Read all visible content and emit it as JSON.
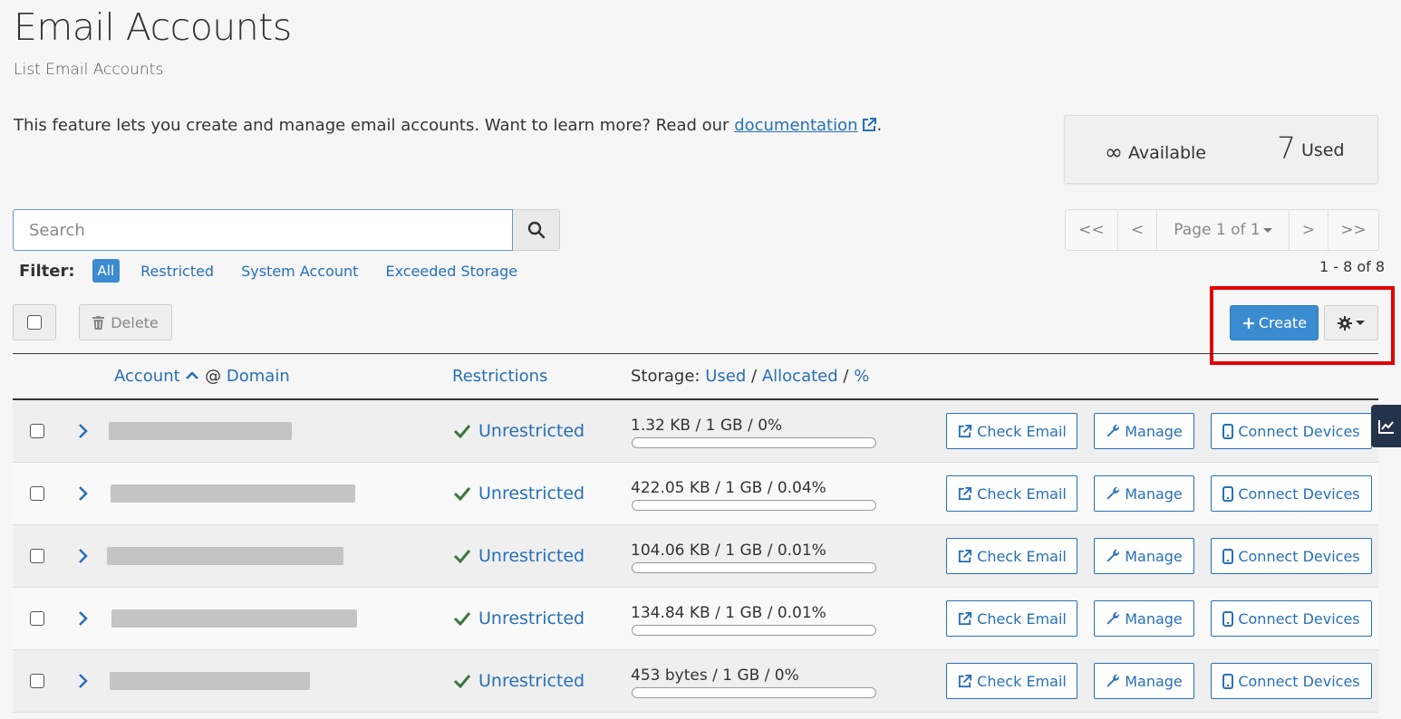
{
  "header": {
    "title": "Email Accounts",
    "subtitle": "List Email Accounts"
  },
  "intro": {
    "text_before": "This feature lets you create and manage email accounts. Want to learn more? Read our ",
    "link_label": "documentation",
    "text_after": "."
  },
  "stats": {
    "available_symbol": "∞",
    "available_label": "Available",
    "used_count": "7",
    "used_label": "Used"
  },
  "search": {
    "placeholder": "Search",
    "value": ""
  },
  "filter": {
    "label": "Filter:",
    "options": [
      "All",
      "Restricted",
      "System Account",
      "Exceeded Storage"
    ],
    "selected": "All"
  },
  "pagination": {
    "first": "<<",
    "prev": "<",
    "page_label": "Page 1 of 1",
    "next": ">",
    "last": ">>",
    "count_text": "1 - 8 of 8"
  },
  "toolbar": {
    "delete_label": "Delete",
    "create_label": "Create"
  },
  "table": {
    "columns": {
      "account": "Account",
      "domain_sep": "@",
      "domain": "Domain",
      "restrictions": "Restrictions",
      "storage_prefix": "Storage:",
      "storage_used": "Used",
      "storage_allocated": "Allocated",
      "storage_percent": "%",
      "sep": "/"
    },
    "rows": [
      {
        "restriction": "Unrestricted",
        "usage": "1.32 KB / 1 GB / 0%"
      },
      {
        "restriction": "Unrestricted",
        "usage": "422.05 KB / 1 GB / 0.04%"
      },
      {
        "restriction": "Unrestricted",
        "usage": "104.06 KB / 1 GB / 0.01%"
      },
      {
        "restriction": "Unrestricted",
        "usage": "134.84 KB / 1 GB / 0.01%"
      },
      {
        "restriction": "Unrestricted",
        "usage": "453 bytes / 1 GB / 0%"
      }
    ],
    "row_actions": {
      "check_email": "Check Email",
      "manage": "Manage",
      "connect_devices": "Connect Devices"
    }
  },
  "icons": {
    "search": "search-icon",
    "trash": "trash-icon",
    "gear": "gear-icon",
    "external": "external-link-icon",
    "wrench": "wrench-icon",
    "mobile": "mobile-icon",
    "check": "check-icon",
    "chevron": "chevron-right-icon",
    "chart": "chart-icon"
  },
  "colors": {
    "link": "#2670b8",
    "primary_button": "#3b8bd0",
    "highlight": "#e00000",
    "check_green": "#3c763d",
    "side_tab": "#25334a"
  }
}
